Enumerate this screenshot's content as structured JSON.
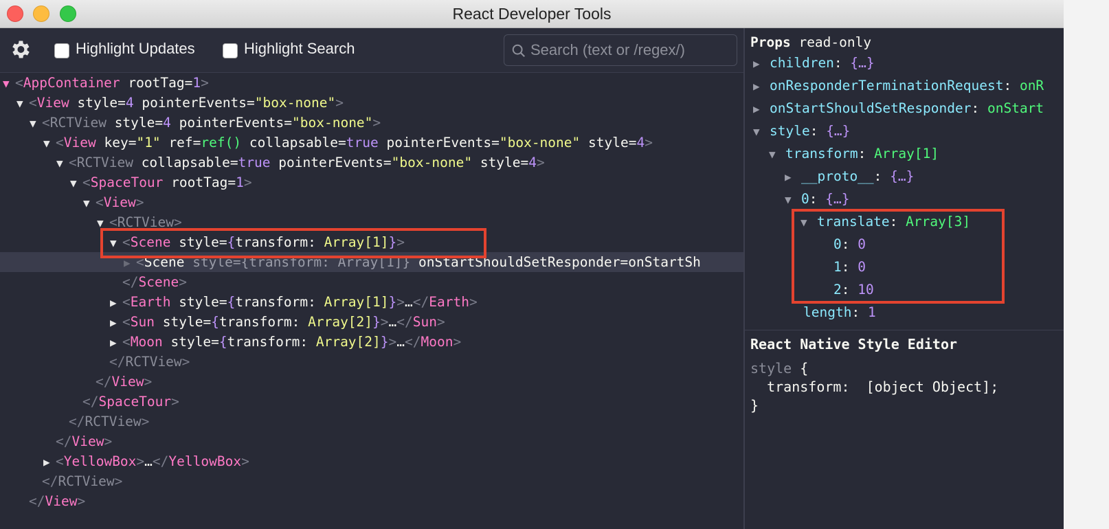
{
  "window": {
    "title": "React Developer Tools"
  },
  "toolbar": {
    "highlight_updates": "Highlight Updates",
    "highlight_search": "Highlight Search",
    "search_placeholder": "Search (text or /regex/)"
  },
  "tree": {
    "app_container": "AppContainer",
    "root_tag_attr": "rootTag",
    "eq": "=",
    "one": "1",
    "four": "4",
    "view": "View",
    "rctview": "RCTView",
    "space_tour": "SpaceTour",
    "scene": "Scene",
    "earth": "Earth",
    "sun": "Sun",
    "moon": "Moon",
    "yellow_box": "YellowBox",
    "style_attr": "style",
    "pointer_events_attr": "pointerEvents",
    "box_none": "\"box-none\"",
    "key_attr": "key",
    "key_val": "\"1\"",
    "ref_attr": "ref",
    "ref_val": "ref()",
    "collapsable_attr": "collapsable",
    "true_val": "true",
    "transform_key": "transform",
    "colon": ":",
    "array1": "Array[1]",
    "array2": "Array[2]",
    "ellipsis": "…",
    "on_start_attr": "onStartShouldSetResponder",
    "on_start_val": "onStartSh"
  },
  "props": {
    "header": "Props",
    "readonly": "read-only",
    "children_key": "children",
    "obj": "{…}",
    "on_responder_key": "onResponderTerminationRequest",
    "on_responder_val": "onR",
    "on_start_key": "onStartShouldSetResponder",
    "on_start_val": "onStart",
    "style_key": "style",
    "transform_key": "transform",
    "array1": "Array[1]",
    "proto_key": "__proto__",
    "zero_key": "0",
    "translate_key": "translate",
    "array3": "Array[3]",
    "t0_key": "0",
    "t0_val": "0",
    "t1_key": "1",
    "t1_val": "0",
    "t2_key": "2",
    "t2_val": "10",
    "length_key": "length",
    "length_val": "1"
  },
  "style_editor": {
    "header": "React Native Style Editor",
    "line1_kw": "style",
    "line1_brace": "{",
    "line2": "  transform:  [object Object];",
    "line3": "}"
  },
  "colors": {
    "highlight_box": "#e4432f",
    "tag": "#ff79c6",
    "string": "#f1fa8c",
    "number": "#bd93f9",
    "key": "#8be9fd",
    "green": "#50fa7b"
  }
}
